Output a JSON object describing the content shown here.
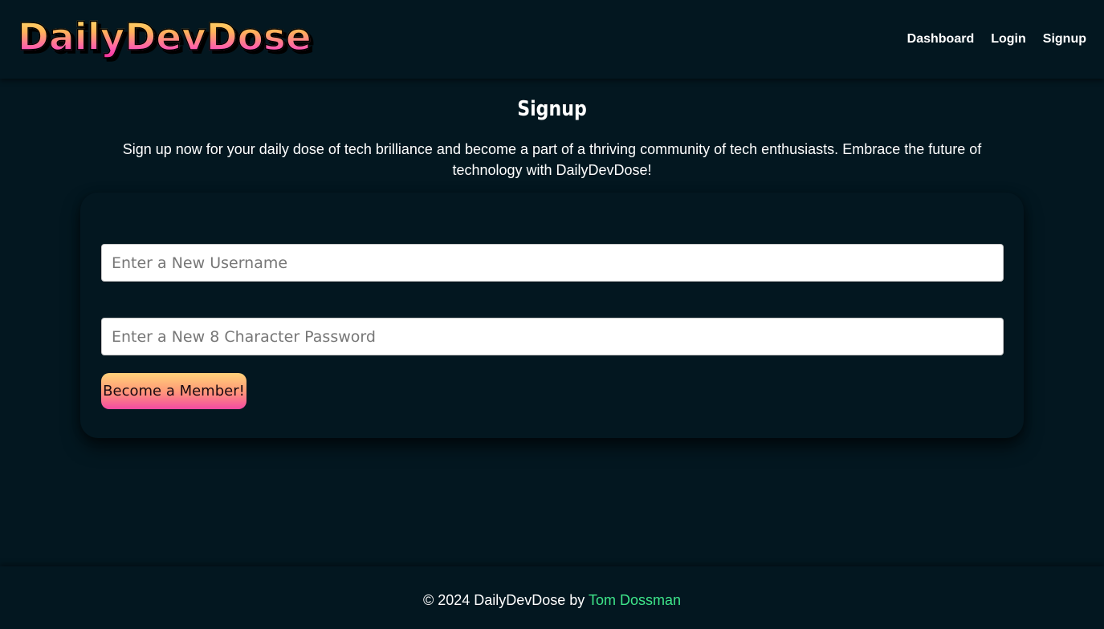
{
  "header": {
    "logo_text": "DailyDevDose",
    "nav": [
      {
        "label": "Dashboard"
      },
      {
        "label": "Login"
      },
      {
        "label": "Signup"
      }
    ]
  },
  "main": {
    "title": "Signup",
    "intro": "Sign up now for your daily dose of tech brilliance and become a part of a thriving community of tech enthusiasts. Embrace the future of technology with DailyDevDose!",
    "form": {
      "username_placeholder": "Enter a New Username",
      "username_value": "",
      "password_placeholder": "Enter a New 8 Character Password",
      "password_value": "",
      "submit_label": "Become a Member!"
    }
  },
  "footer": {
    "copyright": "© 2024 DailyDevDose by ",
    "author": "Tom Dossman"
  },
  "colors": {
    "background": "#031720",
    "author_link": "#3ee68a",
    "button_gradient_top": "#ffd27a",
    "button_gradient_bottom": "#f44aa2",
    "logo_gradient_top": "#ffe36b",
    "logo_gradient_bottom": "#f0309a"
  }
}
